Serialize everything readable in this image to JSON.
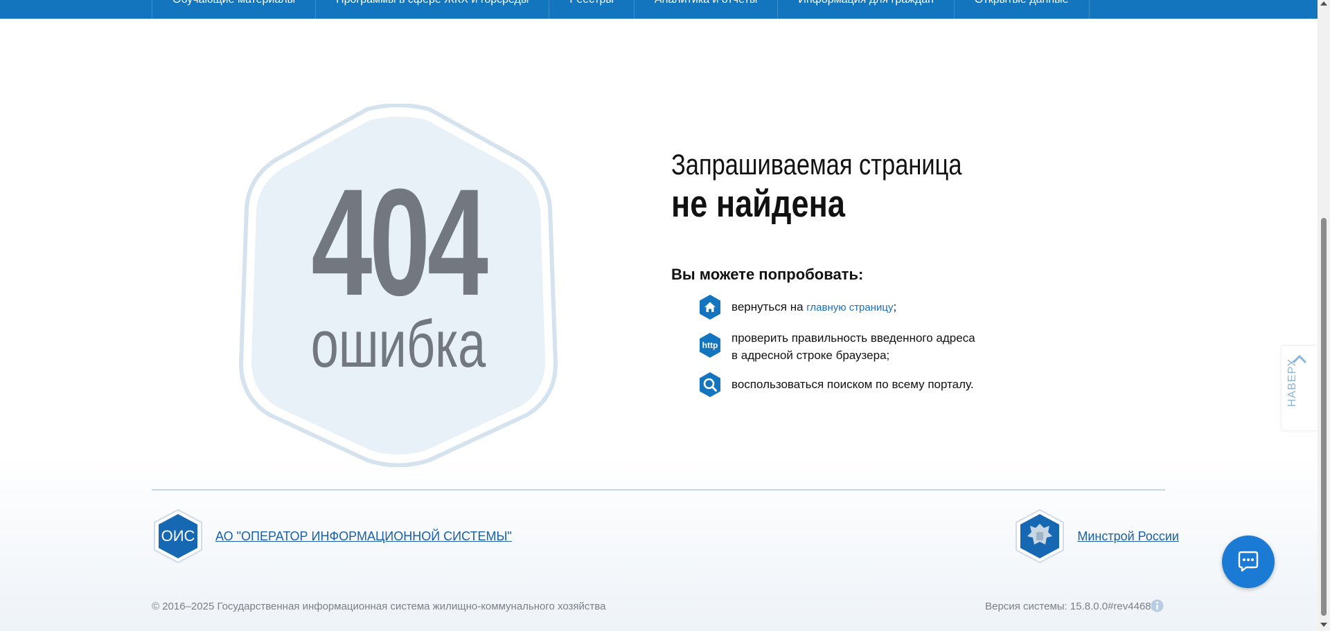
{
  "nav": {
    "items": [
      "Обучающие материалы",
      "Программы в сфере ЖКХ и горсреды",
      "Реестры",
      "Аналитика и отчеты",
      "Информация для граждан",
      "Открытые данные"
    ]
  },
  "error": {
    "code": "404",
    "word": "ошибка",
    "title_line1": "Запрашиваемая страница",
    "title_line2": "не найдена",
    "try_heading": "Вы можете попробовать:",
    "suggestions": [
      {
        "icon": "home-icon",
        "text_before": "вернуться на ",
        "link": "главную страницу",
        "text_after": ";"
      },
      {
        "icon": "http-icon",
        "icon_text": "http",
        "line1": "проверить правильность введенного адреса",
        "line2": "в адресной строке браузера;"
      },
      {
        "icon": "search-icon",
        "text": "воспользоваться поиском по всему порталу."
      }
    ]
  },
  "footer": {
    "org_logo_text": "ОИС",
    "org_name": "АО \"ОПЕРАТОР ИНФОРМАЦИОННОЙ СИСТЕМЫ\"",
    "ministry_name": "Минстрой России",
    "copyright": "© 2016–2025 Государственная информационная система жилищно-коммунального хозяйства",
    "version": "Версия системы: 15.8.0.0#rev44681"
  },
  "widgets": {
    "to_top_label": "НАВЕРХ"
  },
  "colors": {
    "brand_blue": "#1275bd",
    "link_blue": "#1a6fc0",
    "digits_gray": "#737780",
    "hex_fill": "#e8f0f8",
    "hex_stroke": "#d5e3ef"
  }
}
